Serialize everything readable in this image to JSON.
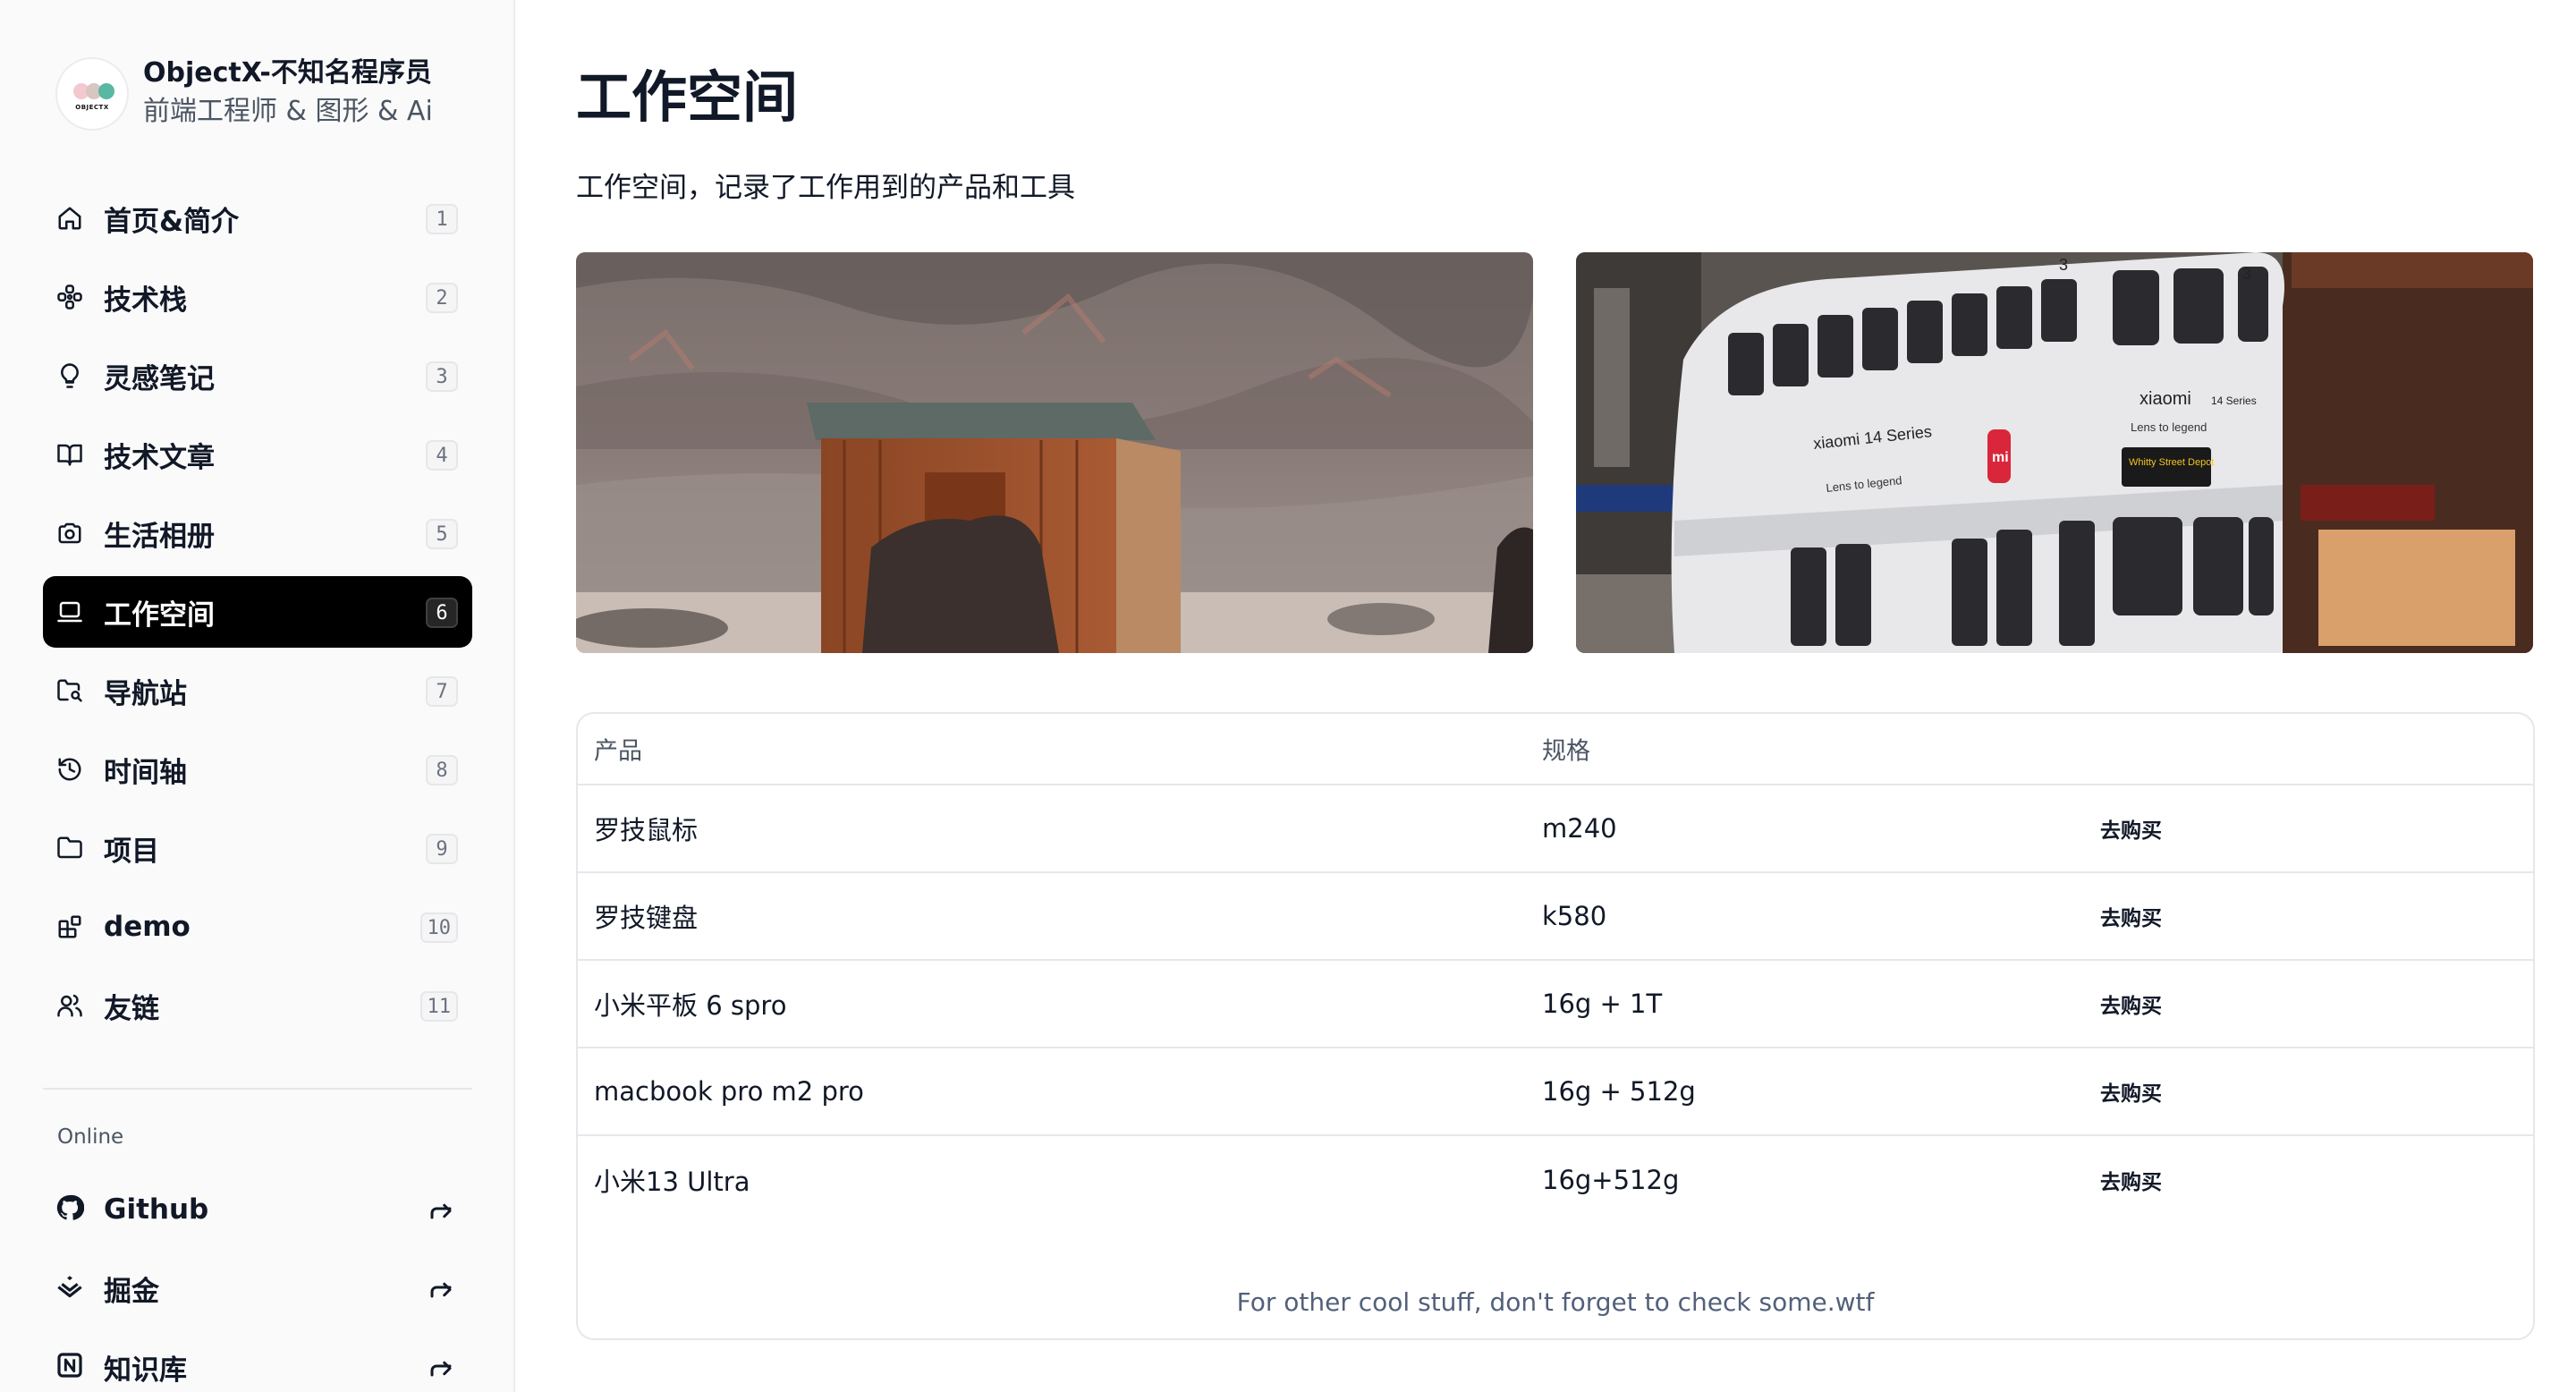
{
  "profile": {
    "name": "ObjectX-不知名程序员",
    "role": "前端工程师 & 图形 & Ai",
    "avatar_text": "OBJECTX"
  },
  "nav": {
    "items": [
      {
        "label": "首页&简介",
        "badge": "1",
        "icon": "home-icon"
      },
      {
        "label": "技术栈",
        "badge": "2",
        "icon": "stack-icon"
      },
      {
        "label": "灵感笔记",
        "badge": "3",
        "icon": "lightbulb-icon"
      },
      {
        "label": "技术文章",
        "badge": "4",
        "icon": "book-icon"
      },
      {
        "label": "生活相册",
        "badge": "5",
        "icon": "camera-icon"
      },
      {
        "label": "工作空间",
        "badge": "6",
        "icon": "laptop-icon",
        "active": true
      },
      {
        "label": "导航站",
        "badge": "7",
        "icon": "folder-search-icon"
      },
      {
        "label": "时间轴",
        "badge": "8",
        "icon": "history-icon"
      },
      {
        "label": "项目",
        "badge": "9",
        "icon": "folder-icon"
      },
      {
        "label": "demo",
        "badge": "10",
        "icon": "blocks-icon"
      },
      {
        "label": "友链",
        "badge": "11",
        "icon": "users-icon"
      }
    ]
  },
  "online": {
    "section_label": "Online",
    "items": [
      {
        "label": "Github",
        "icon": "github-icon"
      },
      {
        "label": "掘金",
        "icon": "juejin-icon"
      },
      {
        "label": "知识库",
        "icon": "notion-icon"
      }
    ]
  },
  "main": {
    "title": "工作空间",
    "description": "工作空间，记录了工作用到的产品和工具",
    "tram_texts": {
      "brand": "xiaomi",
      "series": "14 Series",
      "slogan": "Lens to legend",
      "route": "3",
      "sign": "Whitty Street Depot"
    }
  },
  "table": {
    "headers": [
      "产品",
      "规格"
    ],
    "rows": [
      {
        "product": "罗技鼠标",
        "spec": "m240",
        "action": "去购买"
      },
      {
        "product": "罗技键盘",
        "spec": "k580",
        "action": "去购买"
      },
      {
        "product": "小米平板 6 spro",
        "spec": "16g + 1T",
        "action": "去购买"
      },
      {
        "product": "macbook pro m2 pro",
        "spec": "16g + 512g",
        "action": "去购买"
      },
      {
        "product": "小米13 Ultra",
        "spec": "16g+512g",
        "action": "去购买"
      }
    ],
    "caption": "For other cool stuff, don't forget to check some.wtf"
  },
  "colors": {
    "active_bg": "#000000",
    "sidebar_bg": "#fafafa",
    "caption": "#52607a"
  }
}
